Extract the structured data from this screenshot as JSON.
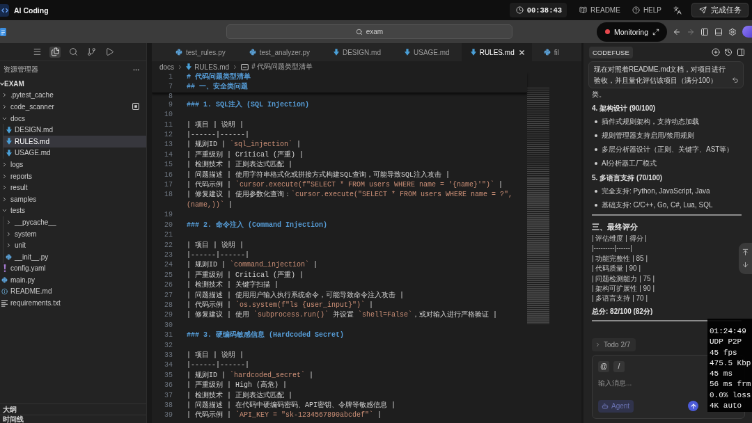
{
  "title_bar": {
    "app_name": "AI Coding",
    "timer": "00:38:43",
    "links": [
      {
        "label": "README",
        "kind": "readme"
      },
      {
        "label": "HELP",
        "kind": "help"
      }
    ],
    "finish_button": "完成任务"
  },
  "command_bar": {
    "search_value": "exam",
    "monitoring": {
      "label": "Monitoring",
      "recording": true
    },
    "nav": [
      {
        "kind": "back",
        "disabled": false
      },
      {
        "kind": "forward",
        "disabled": true
      }
    ]
  },
  "activity_bar": [
    {
      "kind": "menu",
      "selected": false
    },
    {
      "kind": "files",
      "selected": true
    },
    {
      "kind": "search",
      "selected": false
    },
    {
      "kind": "source_control",
      "selected": false
    },
    {
      "kind": "run",
      "selected": false
    }
  ],
  "explorer": {
    "title": "资源管理器",
    "root": {
      "label": "EXAM",
      "expanded": true
    },
    "tree": [
      {
        "name": ".pytest_cache",
        "kind": "folder",
        "expanded": false,
        "selected": false,
        "marked": false
      },
      {
        "name": "code_scanner",
        "kind": "folder",
        "expanded": false,
        "selected": false,
        "marked": true
      },
      {
        "name": "docs",
        "kind": "folder",
        "expanded": true,
        "selected": false,
        "marked": false,
        "children": [
          {
            "name": "DESIGN.md",
            "kind": "markdown",
            "selected": false,
            "marked": false
          },
          {
            "name": "RULES.md",
            "kind": "markdown",
            "selected": true,
            "marked": false
          },
          {
            "name": "USAGE.md",
            "kind": "markdown",
            "selected": false,
            "marked": false
          }
        ]
      },
      {
        "name": "logs",
        "kind": "folder",
        "expanded": false,
        "selected": false,
        "marked": false
      },
      {
        "name": "reports",
        "kind": "folder",
        "expanded": false,
        "selected": false,
        "marked": false
      },
      {
        "name": "result",
        "kind": "folder",
        "expanded": false,
        "selected": false,
        "marked": false
      },
      {
        "name": "samples",
        "kind": "folder",
        "expanded": false,
        "selected": false,
        "marked": false
      },
      {
        "name": "tests",
        "kind": "folder",
        "expanded": true,
        "selected": false,
        "marked": false,
        "children": [
          {
            "name": "__pycache__",
            "kind": "folder",
            "expanded": false,
            "selected": false,
            "marked": false
          },
          {
            "name": "system",
            "kind": "folder",
            "expanded": false,
            "selected": false,
            "marked": false
          },
          {
            "name": "unit",
            "kind": "folder",
            "expanded": false,
            "selected": false,
            "marked": false
          },
          {
            "name": "__init__.py",
            "kind": "python",
            "selected": false,
            "marked": false
          }
        ]
      },
      {
        "name": "config.yaml",
        "kind": "yaml",
        "selected": false,
        "marked": false
      },
      {
        "name": "main.py",
        "kind": "python",
        "selected": false,
        "marked": false
      },
      {
        "name": "README.md",
        "kind": "info",
        "selected": false,
        "marked": false
      },
      {
        "name": "requirements.txt",
        "kind": "text",
        "selected": false,
        "marked": false
      }
    ],
    "sections": [
      {
        "label": "大纲"
      },
      {
        "label": "时间线"
      }
    ]
  },
  "editor": {
    "tabs": [
      {
        "label": "test_rules.py",
        "kind": "python",
        "selected": false
      },
      {
        "label": "test_analyzer.py",
        "kind": "python",
        "selected": false
      },
      {
        "label": "DESIGN.md",
        "kind": "markdown",
        "selected": false
      },
      {
        "label": "USAGE.md",
        "kind": "markdown",
        "selected": false
      },
      {
        "label": "RULES.md",
        "kind": "markdown",
        "selected": true
      },
      {
        "label": "fil",
        "kind": "python",
        "selected": false
      }
    ],
    "breadcrumbs": [
      {
        "label": "docs",
        "kind": "folder"
      },
      {
        "label": "RULES.md",
        "kind": "markdown"
      },
      {
        "label": "# 代码问题类型清单",
        "kind": "symbol"
      }
    ],
    "sticky_lines": [
      {
        "number": "1",
        "segments": [
          {
            "kind": "heading",
            "text": "# 代码问题类型清单"
          }
        ]
      },
      {
        "number": "7",
        "segments": [
          {
            "kind": "heading",
            "text": "## 一、安全类问题"
          }
        ]
      }
    ],
    "lines": [
      {
        "number": "8"
      },
      {
        "number": "9",
        "segments": [
          {
            "kind": "heading",
            "text": "### 1. SQL注入 (SQL Injection)"
          }
        ]
      },
      {
        "number": "10"
      },
      {
        "number": "11",
        "segments": [
          {
            "kind": "plain",
            "text": "| 项目 | 说明 |"
          }
        ]
      },
      {
        "number": "12",
        "segments": [
          {
            "kind": "plain",
            "text": "|------|------|"
          }
        ]
      },
      {
        "number": "13",
        "segments": [
          {
            "kind": "plain",
            "text": "| 规则ID | "
          },
          {
            "kind": "code",
            "text": "`sql_injection`"
          },
          {
            "kind": "plain",
            "text": " |"
          }
        ]
      },
      {
        "number": "14",
        "segments": [
          {
            "kind": "plain",
            "text": "| 严重级别 | Critical (严重) |"
          }
        ]
      },
      {
        "number": "15",
        "segments": [
          {
            "kind": "plain",
            "text": "| 检测技术 | 正则表达式匹配 |"
          }
        ]
      },
      {
        "number": "16",
        "segments": [
          {
            "kind": "plain",
            "text": "| 问题描述 | 使用字符串格式化或拼接方式构建SQL查询，可能导致SQL注入攻击 |"
          }
        ]
      },
      {
        "number": "17",
        "segments": [
          {
            "kind": "plain",
            "text": "| 代码示例 | "
          },
          {
            "kind": "code",
            "text": "`cursor.execute(f\"SELECT * FROM users WHERE name = '{name}'\")`"
          },
          {
            "kind": "plain",
            "text": " |"
          }
        ]
      },
      {
        "number": "18",
        "segments": [
          {
            "kind": "plain",
            "text": "| 修复建议 | 使用参数化查询："
          },
          {
            "kind": "code",
            "text": "`cursor.execute(\"SELECT * FROM users WHERE name = ?\", (name,))`"
          },
          {
            "kind": "plain",
            "text": " |"
          }
        ]
      },
      {
        "number": "19"
      },
      {
        "number": "20",
        "segments": [
          {
            "kind": "heading",
            "text": "### 2. 命令注入 (Command Injection)"
          }
        ]
      },
      {
        "number": "21"
      },
      {
        "number": "22",
        "segments": [
          {
            "kind": "plain",
            "text": "| 项目 | 说明 |"
          }
        ]
      },
      {
        "number": "23",
        "segments": [
          {
            "kind": "plain",
            "text": "|------|------|"
          }
        ]
      },
      {
        "number": "24",
        "segments": [
          {
            "kind": "plain",
            "text": "| 规则ID | "
          },
          {
            "kind": "code",
            "text": "`command_injection`"
          },
          {
            "kind": "plain",
            "text": " |"
          }
        ]
      },
      {
        "number": "25",
        "segments": [
          {
            "kind": "plain",
            "text": "| 严重级别 | Critical (严重) |"
          }
        ]
      },
      {
        "number": "26",
        "segments": [
          {
            "kind": "plain",
            "text": "| 检测技术 | 关键字扫描 |"
          }
        ]
      },
      {
        "number": "27",
        "segments": [
          {
            "kind": "plain",
            "text": "| 问题描述 | 使用用户输入执行系统命令，可能导致命令注入攻击 |"
          }
        ]
      },
      {
        "number": "28",
        "segments": [
          {
            "kind": "plain",
            "text": "| 代码示例 | "
          },
          {
            "kind": "code",
            "text": "`os.system(f\"ls {user_input}\")`"
          },
          {
            "kind": "plain",
            "text": " |"
          }
        ]
      },
      {
        "number": "29",
        "segments": [
          {
            "kind": "plain",
            "text": "| 修复建议 | 使用 "
          },
          {
            "kind": "code",
            "text": "`subprocess.run()`"
          },
          {
            "kind": "plain",
            "text": " 并设置 "
          },
          {
            "kind": "code",
            "text": "`shell=False`"
          },
          {
            "kind": "plain",
            "text": "，或对输入进行严格验证 |"
          }
        ]
      },
      {
        "number": "30"
      },
      {
        "number": "31",
        "segments": [
          {
            "kind": "heading",
            "text": "### 3. 硬编码敏感信息 (Hardcoded Secret)"
          }
        ]
      },
      {
        "number": "32"
      },
      {
        "number": "33",
        "segments": [
          {
            "kind": "plain",
            "text": "| 项目 | 说明 |"
          }
        ]
      },
      {
        "number": "34",
        "segments": [
          {
            "kind": "plain",
            "text": "|------|------|"
          }
        ]
      },
      {
        "number": "35",
        "segments": [
          {
            "kind": "plain",
            "text": "| 规则ID | "
          },
          {
            "kind": "code",
            "text": "`hardcoded_secret`"
          },
          {
            "kind": "plain",
            "text": " |"
          }
        ]
      },
      {
        "number": "36",
        "segments": [
          {
            "kind": "plain",
            "text": "| 严重级别 | High (高危) |"
          }
        ]
      },
      {
        "number": "37",
        "segments": [
          {
            "kind": "plain",
            "text": "| 检测技术 | 正则表达式匹配 |"
          }
        ]
      },
      {
        "number": "38",
        "segments": [
          {
            "kind": "plain",
            "text": "| 问题描述 | 在代码中硬编码密码、API密钥、令牌等敏感信息 |"
          }
        ]
      },
      {
        "number": "39",
        "segments": [
          {
            "kind": "plain",
            "text": "| 代码示例 | "
          },
          {
            "kind": "code",
            "text": "`API_KEY = \"sk-1234567890abcdef\"`"
          },
          {
            "kind": "plain",
            "text": " |"
          }
        ]
      }
    ]
  },
  "assistant": {
    "tab": "CODEFUSE",
    "prompt": "现在对照着README.md文档，对项目进行验收，并且量化评估该项目（满分100）",
    "blocks": [
      {
        "kind": "text",
        "text": "类。"
      },
      {
        "kind": "heading",
        "text": "4. 架构设计 (90/100)"
      },
      {
        "kind": "bullet",
        "text": "插件式规则架构，支持动态加载"
      },
      {
        "kind": "bullet",
        "text": "规则管理器支持启用/禁用规则"
      },
      {
        "kind": "bullet",
        "text": "多层分析器设计（正则、关键字、AST等）"
      },
      {
        "kind": "bullet",
        "text": "AI分析器工厂模式"
      },
      {
        "kind": "heading",
        "text": "5. 多语言支持 (70/100)"
      },
      {
        "kind": "bullet",
        "text": "完全支持: Python, JavaScript, Java"
      },
      {
        "kind": "bullet",
        "text": "基础支持: C/C++, Go, C#, Lua, SQL"
      },
      {
        "kind": "rule"
      },
      {
        "kind": "title",
        "text": "三、最终评分"
      },
      {
        "kind": "table_row",
        "text": "| 评估维度 | 得分 |"
      },
      {
        "kind": "table_row",
        "text": "|---------|------|"
      },
      {
        "kind": "table_row",
        "text": "| 功能完整性 | 85 |"
      },
      {
        "kind": "table_row",
        "text": "| 代码质量 | 90 |"
      },
      {
        "kind": "table_row",
        "text": "| 问题检测能力 | 75 |"
      },
      {
        "kind": "table_row",
        "text": "| 架构可扩展性 | 90 |"
      },
      {
        "kind": "table_row",
        "text": "| 多语言支持 | 70 |"
      },
      {
        "kind": "total",
        "text": "总分: 82/100 (82分)"
      },
      {
        "kind": "rule"
      }
    ],
    "todo": "Todo 2/7",
    "input": {
      "mention": "@",
      "command": "/",
      "placeholder": "输入消息...",
      "mode": "Agent"
    }
  },
  "stream_stats": [
    "01:24:49",
    "UDP P2P",
    "45 fps",
    "475.5 Kbp",
    "45 ms",
    "56 ms frm",
    "0.0% loss",
    "4K auto"
  ]
}
